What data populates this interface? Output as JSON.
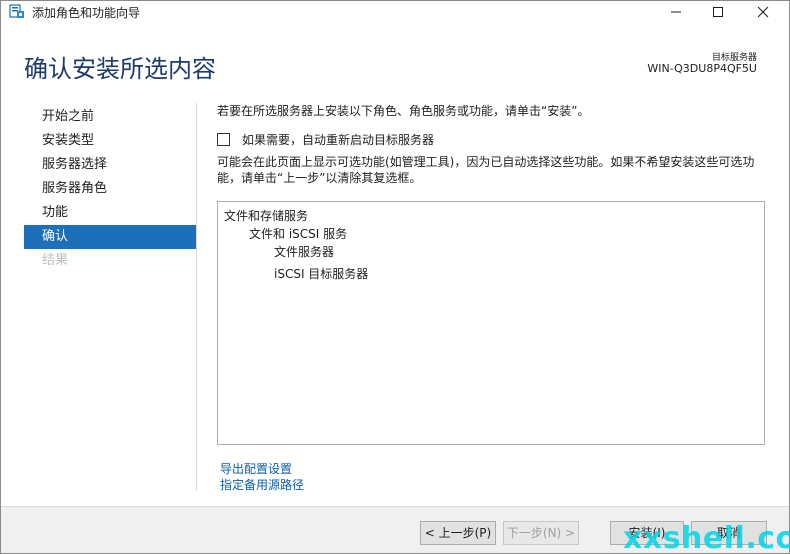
{
  "window": {
    "title": "添加角色和功能向导"
  },
  "header": {
    "title": "确认安装所选内容",
    "destination_label": "目标服务器",
    "destination_value": "WIN-Q3DU8P4QF5U"
  },
  "nav": {
    "items": [
      {
        "label": "开始之前"
      },
      {
        "label": "安装类型"
      },
      {
        "label": "服务器选择"
      },
      {
        "label": "服务器角色"
      },
      {
        "label": "功能"
      },
      {
        "label": "确认",
        "active": true
      },
      {
        "label": "结果",
        "disabled": true
      }
    ]
  },
  "main": {
    "intro": "若要在所选服务器上安装以下角色、角色服务或功能，请单击“安装”。",
    "restart_label": "如果需要，自动重新启动目标服务器",
    "restart_checked": false,
    "note": "可能会在此页面上显示可选功能(如管理工具)，因为已自动选择这些功能。如果不希望安装这些可选功能，请单击“上一步”以清除其复选框。",
    "features": [
      {
        "label": "文件和存储服务",
        "level": 0
      },
      {
        "label": "文件和 iSCSI 服务",
        "level": 1
      },
      {
        "label": "文件服务器",
        "level": 2
      },
      {
        "label": "iSCSI 目标服务器",
        "level": 2
      }
    ],
    "export_link": "导出配置设置",
    "source_link": "指定备用源路径"
  },
  "footer": {
    "prev_label": "< 上一步(P)",
    "next_label": "下一步(N) >",
    "install_label": "安装(I)",
    "cancel_label": "取消"
  },
  "watermark": "xxshell.com",
  "colors": {
    "accent": "#1c6fb8",
    "title": "#1e3b6e",
    "link": "#0b5fa8"
  }
}
